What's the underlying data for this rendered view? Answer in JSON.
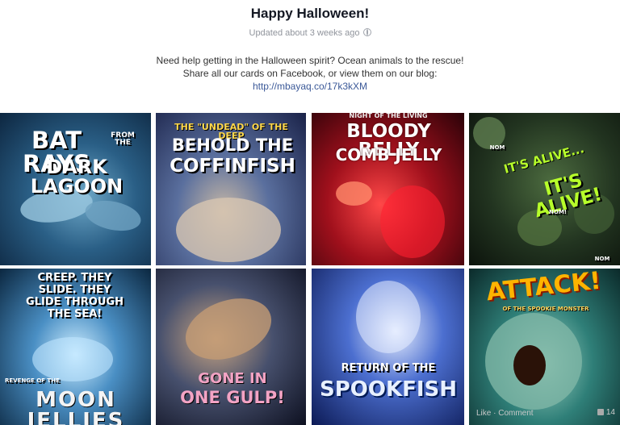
{
  "album": {
    "title": "Happy Halloween!",
    "updated": "Updated about 3 weeks ago",
    "description_line1": "Need help getting in the Halloween spirit? Ocean animals to the rescue!",
    "description_line2": "Share all our cards on Facebook, or view them on our blog:",
    "link": "http://mbayaq.co/17k3kXM"
  },
  "photos": [
    {
      "caption_main": "BAT RAYS",
      "caption_small": "FROM THE",
      "caption_sub": "DARK LAGOON"
    },
    {
      "caption_top": "THE \"UNDEAD\" OF THE DEEP",
      "caption_main": "BEHOLD THE",
      "caption_sub": "COFFINFISH"
    },
    {
      "caption_top": "NIGHT OF THE LIVING",
      "caption_main": "BLOODY BELLY",
      "caption_sub": "COMB JELLY"
    },
    {
      "caption_main": "IT'S ALIVE...",
      "caption_sub": "IT'S ALIVE!",
      "caption_small": "NOM",
      "caption_small2": "NOM!",
      "caption_small3": "NOM"
    },
    {
      "caption_main": "CREEP. THEY SLIDE. THEY GLIDE THROUGH THE SEA!",
      "caption_top": "REVENGE OF THE",
      "caption_sub": "MOON JELLIES"
    },
    {
      "caption_main": "GONE IN",
      "caption_sub": "ONE GULP!"
    },
    {
      "caption_main": "RETURN OF THE",
      "caption_sub": "SPOOKFISH"
    },
    {
      "caption_main": "ATTACK!",
      "caption_sub": "OF THE SPOOKIE MONSTER",
      "footer_like": "Like · Comment",
      "like_count": "14"
    }
  ]
}
